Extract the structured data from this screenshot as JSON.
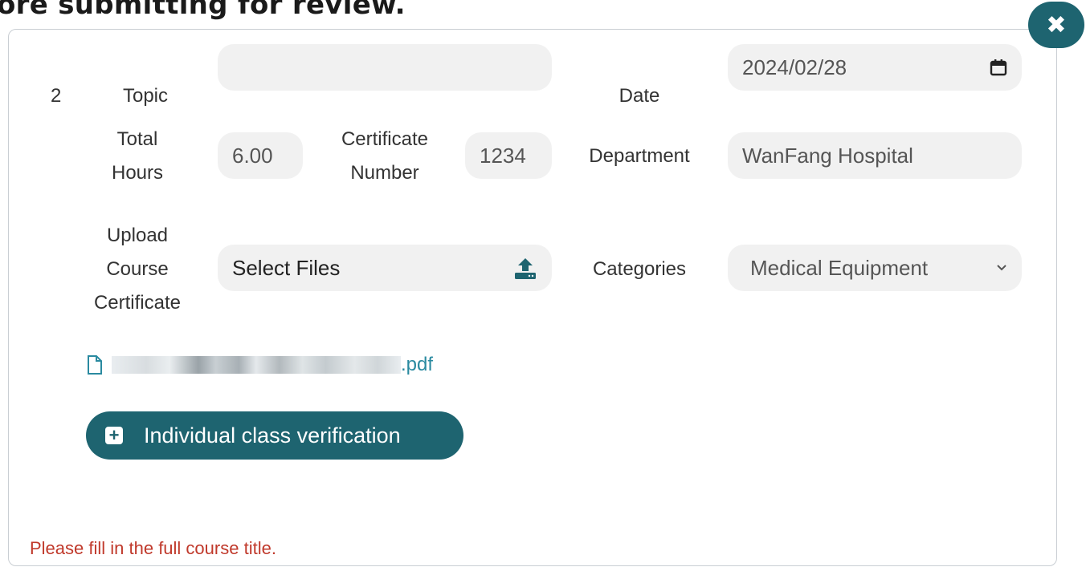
{
  "heading": {
    "text": "ore submitting for review."
  },
  "close": {
    "glyph": "✖"
  },
  "row": {
    "number": "2"
  },
  "labels": {
    "topic": "Topic",
    "date": "Date",
    "total_hours_1": "Total",
    "total_hours_2": "Hours",
    "certificate_number_1": "Certificate",
    "certificate_number_2": "Number",
    "department": "Department",
    "upload_1": "Upload",
    "upload_2": "Course",
    "upload_3": "Certificate",
    "categories": "Categories"
  },
  "fields": {
    "topic_value": "",
    "date_value": "2024/02/28",
    "total_hours_value": "6.00",
    "certificate_number_value": "1234",
    "department_value": "WanFang Hospital",
    "upload_placeholder": "Select Files",
    "category_selected": "Medical Equipment"
  },
  "attachment": {
    "extension": ".pdf"
  },
  "buttons": {
    "individual_verification": "Individual class verification"
  },
  "error": {
    "message": "Please fill in the full course title."
  },
  "icons": {
    "close": "close-icon",
    "calendar": "calendar-icon",
    "upload": "upload-icon",
    "dropdown": "chevron-down-icon",
    "file": "file-icon",
    "plus": "plus-square-icon"
  },
  "colors": {
    "accent": "#1e6470",
    "error": "#c0392b",
    "link": "#2a8aa0",
    "field_bg": "#f1f1f1"
  }
}
